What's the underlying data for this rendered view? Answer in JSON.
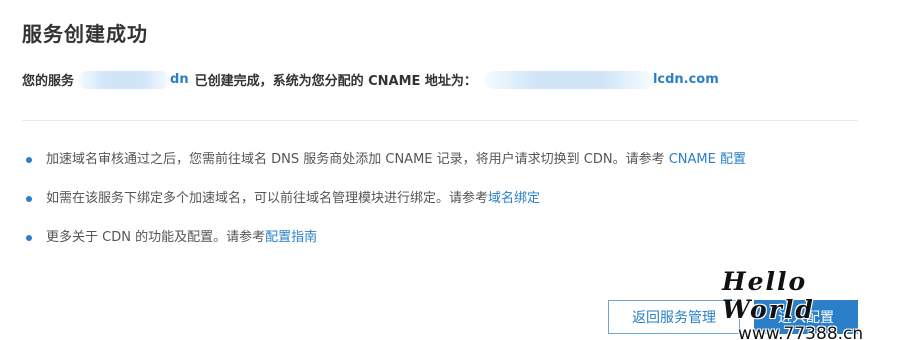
{
  "header": {
    "title": "服务创建成功"
  },
  "result": {
    "prefix": "您的服务",
    "service_suffix": "dn",
    "middle": "已创建完成，系统为您分配的 CNAME 地址为：",
    "cname_suffix": "lcdn.com"
  },
  "tips": [
    {
      "text": "加速域名审核通过之后，您需前往域名 DNS 服务商处添加 CNAME 记录，将用户请求切换到 CDN。请参考 ",
      "link": "CNAME 配置"
    },
    {
      "text": "如需在该服务下绑定多个加速域名，可以前往域名管理模块进行绑定。请参考",
      "link": "域名绑定"
    },
    {
      "text": "更多关于 CDN 的功能及配置。请参考",
      "link": "配置指南"
    }
  ],
  "buttons": {
    "back_label": "返回服务管理",
    "config_label": "进入配置"
  },
  "watermark": {
    "title": "Hello World",
    "url": "www.77388.cn"
  },
  "colors": {
    "accent": "#2a7fc8",
    "text": "#333333",
    "bullet": "#2a7fc8"
  }
}
